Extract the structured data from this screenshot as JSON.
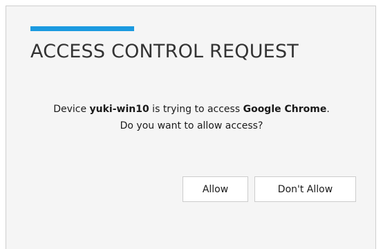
{
  "dialog": {
    "title": "ACCESS CONTROL REQUEST",
    "accent_color": "#1b9ae0",
    "message": {
      "prefix": "Device ",
      "device": "yuki-win10",
      "middle": " is trying to access ",
      "app": "Google Chrome",
      "suffix": ".",
      "question": "Do you want to allow access?"
    },
    "buttons": {
      "allow_label": "Allow",
      "deny_label": "Don't Allow"
    }
  }
}
